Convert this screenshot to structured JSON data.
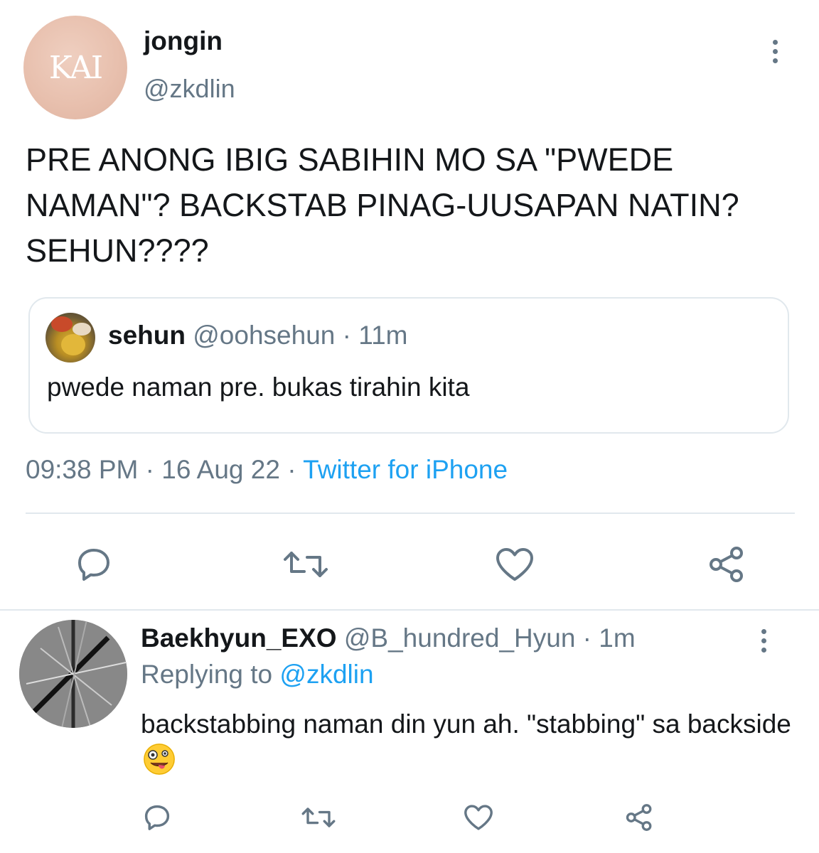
{
  "main_tweet": {
    "author_name": "jongin",
    "author_handle": "@zkdlin",
    "avatar_text": "KAI",
    "text": "PRE ANONG IBIG SABIHIN MO SA \"PWEDE NAMAN\"? BACKSTAB PINAG-UUSAPAN NATIN? SEHUN????",
    "quoted": {
      "author_name": "sehun",
      "author_handle": "@oohsehun",
      "separator": " · ",
      "time": "11m",
      "text": "pwede naman pre. bukas tirahin kita"
    },
    "time": "09:38 PM",
    "date": "16 Aug 22",
    "separator": " · ",
    "source": "Twitter for iPhone",
    "actions": [
      "reply-icon",
      "retweet-icon",
      "like-icon",
      "share-icon"
    ],
    "more_icon": "more-vertical-icon"
  },
  "reply_tweet": {
    "author_name": "Baekhyun_EXO",
    "author_handle": "@B_hundred_Hyun",
    "separator": " · ",
    "time": "1m",
    "replying_prefix": "Replying to ",
    "replying_to": "@zkdlin",
    "text": "backstabbing naman din yun ah. \"stabbing\" sa backside",
    "emoji": "zany-face-emoji",
    "actions": [
      "reply-icon",
      "retweet-icon",
      "like-icon",
      "share-icon"
    ],
    "more_icon": "more-vertical-icon"
  },
  "colors": {
    "text": "#14171a",
    "secondary": "#657786",
    "link": "#1da1f2",
    "border": "#e1e8ed"
  }
}
